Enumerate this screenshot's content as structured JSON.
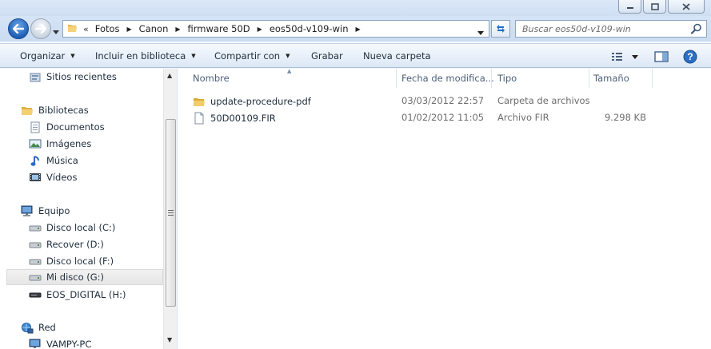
{
  "address": {
    "overflow_marker": "«",
    "crumbs": [
      "Fotos",
      "Canon",
      "firmware 50D",
      "eos50d-v109-win"
    ]
  },
  "search": {
    "placeholder": "Buscar eos50d-v109-win"
  },
  "toolbar": {
    "organize": "Organizar",
    "include_library": "Incluir en biblioteca",
    "share_with": "Compartir con",
    "burn": "Grabar",
    "new_folder": "Nueva carpeta"
  },
  "sidebar": {
    "recent": "Sitios recientes",
    "libraries": "Bibliotecas",
    "documents": "Documentos",
    "images": "Imágenes",
    "music": "Música",
    "videos": "Vídeos",
    "computer": "Equipo",
    "drive_c": "Disco local (C:)",
    "drive_d": "Recover (D:)",
    "drive_f": "Disco local (F:)",
    "drive_g": "Mi disco (G:)",
    "drive_h": "EOS_DIGITAL (H:)",
    "network": "Red",
    "network_pc": "VAMPY-PC"
  },
  "columns": {
    "name": "Nombre",
    "date": "Fecha de modifica...",
    "type": "Tipo",
    "size": "Tamaño"
  },
  "files": [
    {
      "name": "update-procedure-pdf",
      "date": "03/03/2012 22:57",
      "type": "Carpeta de archivos",
      "size": ""
    },
    {
      "name": "50D00109.FIR",
      "date": "01/02/2012 11:05",
      "type": "Archivo FIR",
      "size": "9.298 KB"
    }
  ],
  "icons": {
    "back": "back-arrow-icon",
    "forward": "forward-arrow-icon",
    "folder": "folder-icon",
    "file": "file-icon",
    "search": "search-icon",
    "refresh": "refresh-icon",
    "views": "views-icon",
    "preview_pane": "preview-pane-icon",
    "help": "help-icon"
  }
}
